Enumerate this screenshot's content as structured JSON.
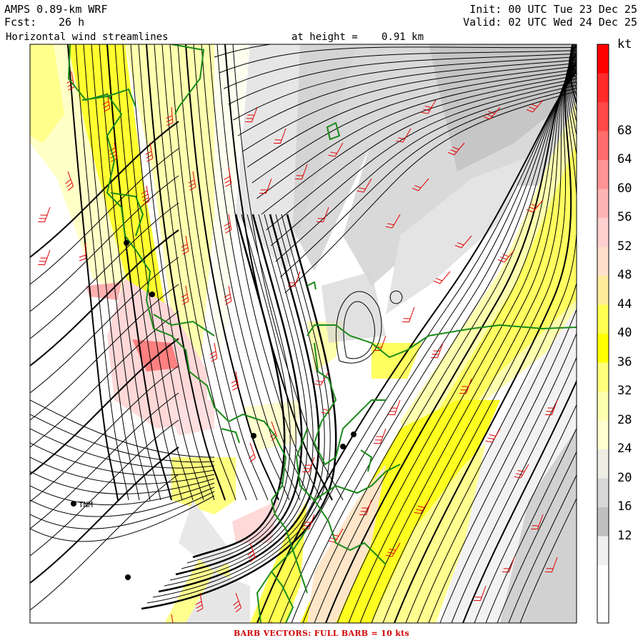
{
  "header": {
    "model": "AMPS 0.89-km WRF",
    "fcst_label": "Fcst:",
    "fcst_value": "26 h",
    "product": "Horizontal wind streamlines",
    "height_label": "at height =",
    "height_value": "0.91 km",
    "init": "Init: 00 UTC Tue 23 Dec 25",
    "valid": "Valid: 02 UTC Wed 24 Dec 25"
  },
  "colorbar": {
    "unit": "kt",
    "tick_labels": [
      "68",
      "64",
      "60",
      "56",
      "52",
      "48",
      "44",
      "40",
      "36",
      "32",
      "28",
      "24",
      "20",
      "16",
      "12"
    ],
    "bins": [
      {
        "min": 76,
        "max": 80,
        "color": "#ff0000"
      },
      {
        "min": 72,
        "max": 76,
        "color": "#ff2a2a"
      },
      {
        "min": 68,
        "max": 72,
        "color": "#ff4848"
      },
      {
        "min": 64,
        "max": 68,
        "color": "#ff6c6c"
      },
      {
        "min": 60,
        "max": 64,
        "color": "#ff9494"
      },
      {
        "min": 56,
        "max": 60,
        "color": "#ffb4b4"
      },
      {
        "min": 52,
        "max": 56,
        "color": "#ffd0d0"
      },
      {
        "min": 48,
        "max": 52,
        "color": "#ffe0cc"
      },
      {
        "min": 44,
        "max": 48,
        "color": "#ffec9a"
      },
      {
        "min": 40,
        "max": 44,
        "color": "#ffff50"
      },
      {
        "min": 36,
        "max": 40,
        "color": "#ffff00"
      },
      {
        "min": 32,
        "max": 36,
        "color": "#ffff7a"
      },
      {
        "min": 28,
        "max": 32,
        "color": "#ffffb0"
      },
      {
        "min": 24,
        "max": 28,
        "color": "#ffffd2"
      },
      {
        "min": 20,
        "max": 24,
        "color": "#eeeee4"
      },
      {
        "min": 16,
        "max": 20,
        "color": "#d8d8d8"
      },
      {
        "min": 12,
        "max": 16,
        "color": "#c0c0c0"
      },
      {
        "min": 8,
        "max": 12,
        "color": "#f0f0f0"
      },
      {
        "min": 0,
        "max": 8,
        "color": "#ffffff"
      }
    ]
  },
  "map": {
    "station_label": "TNM",
    "coastline_color": "#1a8a1a",
    "streamline_color": "#000000",
    "barb_color": "#e00000"
  },
  "footer": "BARB VECTORS:  FULL BARB = 10 kts"
}
